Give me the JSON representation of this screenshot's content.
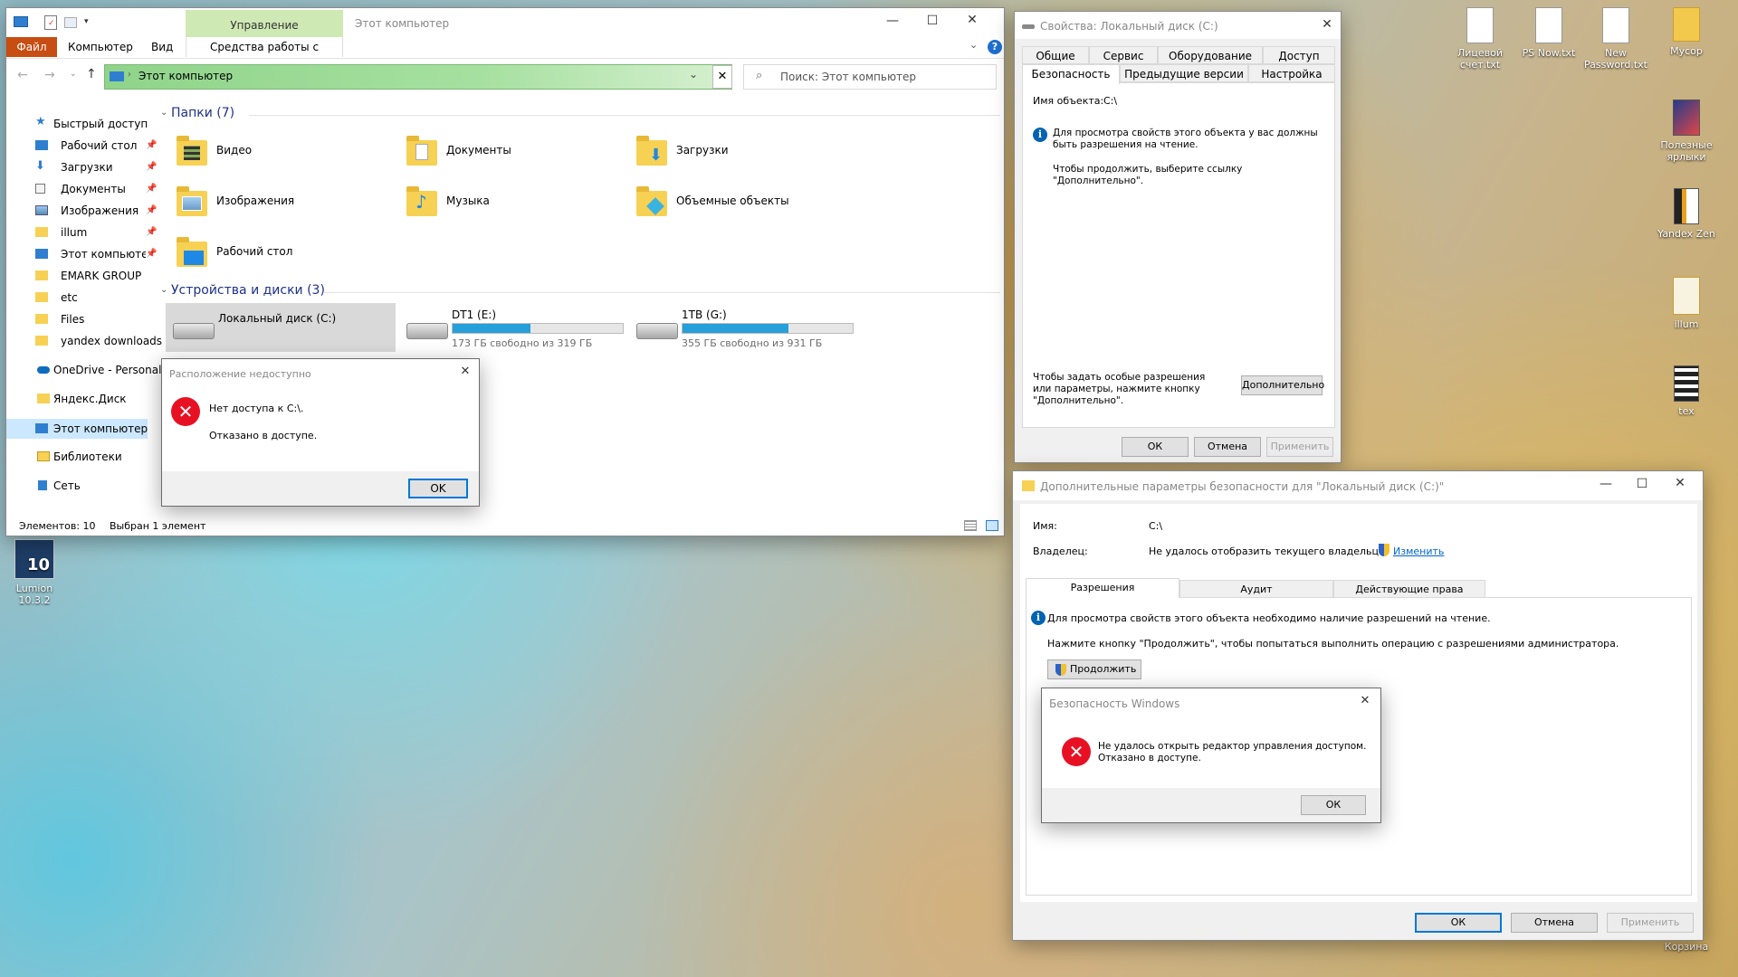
{
  "explorer": {
    "ribbon_tabs": {
      "file": "Файл",
      "computer": "Компьютер",
      "view": "Вид",
      "disk_tools": "Средства работы с дисками"
    },
    "context_group": "Управление",
    "window_title": "Этот компьютер",
    "address": "Этот компьютер",
    "search_placeholder": "Поиск: Этот компьютер",
    "sidebar": [
      {
        "label": "Быстрый доступ",
        "icon": "star-icon",
        "pinned": false
      },
      {
        "label": "Рабочий стол",
        "icon": "desktop-icon",
        "pinned": true
      },
      {
        "label": "Загрузки",
        "icon": "download-icon",
        "pinned": true
      },
      {
        "label": "Документы",
        "icon": "document-icon",
        "pinned": true
      },
      {
        "label": "Изображения",
        "icon": "pictures-icon",
        "pinned": true
      },
      {
        "label": "illum",
        "icon": "folder-icon",
        "pinned": true
      },
      {
        "label": "Этот компьютер",
        "icon": "pc-icon",
        "pinned": true
      },
      {
        "label": "EMARK GROUP",
        "icon": "folder-icon",
        "pinned": false
      },
      {
        "label": "etc",
        "icon": "folder-icon",
        "pinned": false
      },
      {
        "label": "Files",
        "icon": "folder-icon",
        "pinned": false
      },
      {
        "label": "yandex downloads",
        "icon": "folder-icon",
        "pinned": false
      },
      {
        "label": "OneDrive - Personal",
        "icon": "cloud-icon",
        "pinned": false
      },
      {
        "label": "Яндекс.Диск",
        "icon": "yadisk-icon",
        "pinned": false
      },
      {
        "label": "Этот компьютер",
        "icon": "pc-icon",
        "pinned": false
      },
      {
        "label": "Библиотеки",
        "icon": "library-icon",
        "pinned": false
      },
      {
        "label": "Сеть",
        "icon": "network-icon",
        "pinned": false
      }
    ],
    "folders_header": "Папки (7)",
    "folders": [
      "Видео",
      "Документы",
      "Загрузки",
      "Изображения",
      "Музыка",
      "Объемные объекты",
      "Рабочий стол"
    ],
    "devices_header": "Устройства и диски (3)",
    "drives": [
      {
        "name": "Локальный диск (C:)",
        "free": "",
        "used_fraction": 0
      },
      {
        "name": "DT1 (E:)",
        "free": "173 ГБ свободно из 319 ГБ",
        "used_fraction": 0.46
      },
      {
        "name": "1TB (G:)",
        "free": "355 ГБ свободно из 931 ГБ",
        "used_fraction": 0.62
      }
    ],
    "status_items": "Элементов: 10",
    "status_selected": "Выбран 1 элемент"
  },
  "location_dialog": {
    "title": "Расположение недоступно",
    "line1": "Нет доступа к C:\\.",
    "line2": "Отказано в доступе.",
    "ok": "OK"
  },
  "properties": {
    "title": "Свойства: Локальный диск (C:)",
    "tabs_row1": [
      "Общие",
      "Сервис",
      "Оборудование",
      "Доступ"
    ],
    "tabs_row2": [
      "Безопасность",
      "Предыдущие версии",
      "Настройка"
    ],
    "object_label": "Имя объекта:",
    "object_value": "C:\\",
    "info_text": "Для просмотра свойств этого объекта у вас должны быть разрешения на чтение.",
    "continue_text": "Чтобы продолжить, выберите ссылку \"Дополнительно\".",
    "advanced_hint": "Чтобы задать особые разрешения или параметры, нажмите кнопку \"Дополнительно\".",
    "advanced_btn": "Дополнительно",
    "ok": "ОК",
    "cancel": "Отмена",
    "apply": "Применить"
  },
  "advanced": {
    "title": "Дополнительные параметры безопасности для \"Локальный диск (C:)\"",
    "name_label": "Имя:",
    "name_value": "C:\\",
    "owner_label": "Владелец:",
    "owner_value": "Не удалось отобразить текущего владельца.",
    "change_link": "Изменить",
    "tabs": [
      "Разрешения",
      "Аудит",
      "Действующие права доступа"
    ],
    "info_text": "Для просмотра свойств этого объекта необходимо наличие разрешений на чтение.",
    "continue_hint": "Нажмите кнопку \"Продолжить\", чтобы попытаться выполнить операцию с разрешениями администратора.",
    "continue_btn": "Продолжить",
    "ok": "ОК",
    "cancel": "Отмена",
    "apply": "Применить"
  },
  "security_dialog": {
    "title": "Безопасность Windows",
    "line1": "Не удалось открыть редактор управления доступом.",
    "line2": "Отказано в доступе.",
    "ok": "ОК"
  },
  "desktop": {
    "icons_right": [
      "Лицевой счет.txt",
      "PS Now.txt",
      "New Password.txt",
      "Мусор",
      "Полезные ярлыки",
      "Yandex Zen",
      "illum",
      "tex",
      "Корзина"
    ],
    "lumion_label": "Lumion 10.3.2",
    "lumion_version": "10"
  }
}
